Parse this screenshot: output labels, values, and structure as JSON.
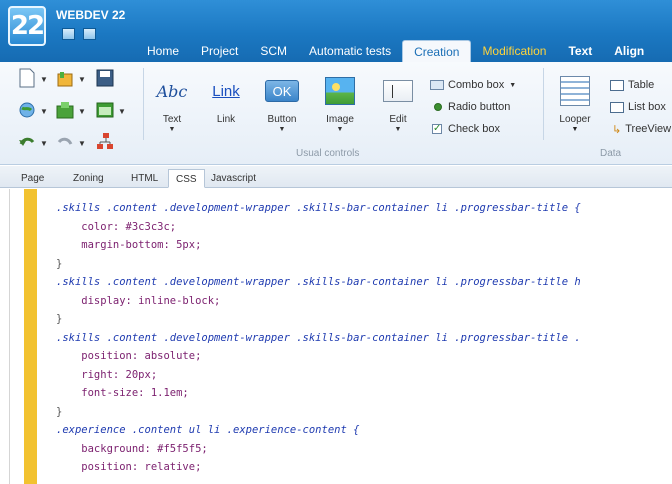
{
  "app": {
    "logo_text": "22",
    "title": "WEBDEV 22"
  },
  "ribbon_tabs": [
    {
      "label": "Home"
    },
    {
      "label": "Project"
    },
    {
      "label": "SCM"
    },
    {
      "label": "Automatic tests"
    },
    {
      "label": "Creation"
    },
    {
      "label": "Modification"
    },
    {
      "label": "Text"
    },
    {
      "label": "Align"
    }
  ],
  "active_tab": "Creation",
  "ribbon": {
    "buttons": {
      "text": {
        "icon_text": "Abc",
        "label": "Text"
      },
      "link": {
        "icon_text": "Link",
        "label": "Link"
      },
      "button": {
        "icon_text": "OK",
        "label": "Button"
      },
      "image": {
        "label": "Image"
      },
      "edit": {
        "label": "Edit"
      }
    },
    "small_controls": {
      "combo": "Combo box",
      "radio": "Radio button",
      "check": "Check box"
    },
    "looper": {
      "label": "Looper"
    },
    "data_controls": {
      "table": "Table",
      "list": "List box",
      "treeview": "TreeView"
    },
    "group_labels": {
      "usual": "Usual controls",
      "data": "Data"
    }
  },
  "editor_tabs": [
    {
      "label": "Page"
    },
    {
      "label": "Zoning"
    },
    {
      "label": "HTML"
    },
    {
      "label": "CSS"
    },
    {
      "label": "Javascript"
    }
  ],
  "active_editor_tab": "CSS",
  "code_lines": [
    {
      "kind": "sel",
      "text": ".skills .content .development-wrapper .skills-bar-container li .progressbar-title {"
    },
    {
      "kind": "prop",
      "text": "    color: #3c3c3c;"
    },
    {
      "kind": "prop",
      "text": "    margin-bottom: 5px;"
    },
    {
      "kind": "brace",
      "text": "}"
    },
    {
      "kind": "sel",
      "text": ".skills .content .development-wrapper .skills-bar-container li .progressbar-title h"
    },
    {
      "kind": "prop",
      "text": "    display: inline-block;"
    },
    {
      "kind": "brace",
      "text": "}"
    },
    {
      "kind": "sel",
      "text": ".skills .content .development-wrapper .skills-bar-container li .progressbar-title ."
    },
    {
      "kind": "prop",
      "text": "    position: absolute;"
    },
    {
      "kind": "prop",
      "text": "    right: 20px;"
    },
    {
      "kind": "prop",
      "text": "    font-size: 1.1em;"
    },
    {
      "kind": "brace",
      "text": "}"
    },
    {
      "kind": "sel",
      "text": ".experience .content ul li .experience-content {"
    },
    {
      "kind": "prop",
      "text": "    background: #f5f5f5;"
    },
    {
      "kind": "prop",
      "text": "    position: relative;"
    }
  ],
  "colors": {
    "accent": "#1b78c2",
    "modification_tab": "#ffd43b",
    "gutter_marker": "#f2c230",
    "selector": "#1f3bb0",
    "property": "#7b1f6e"
  }
}
